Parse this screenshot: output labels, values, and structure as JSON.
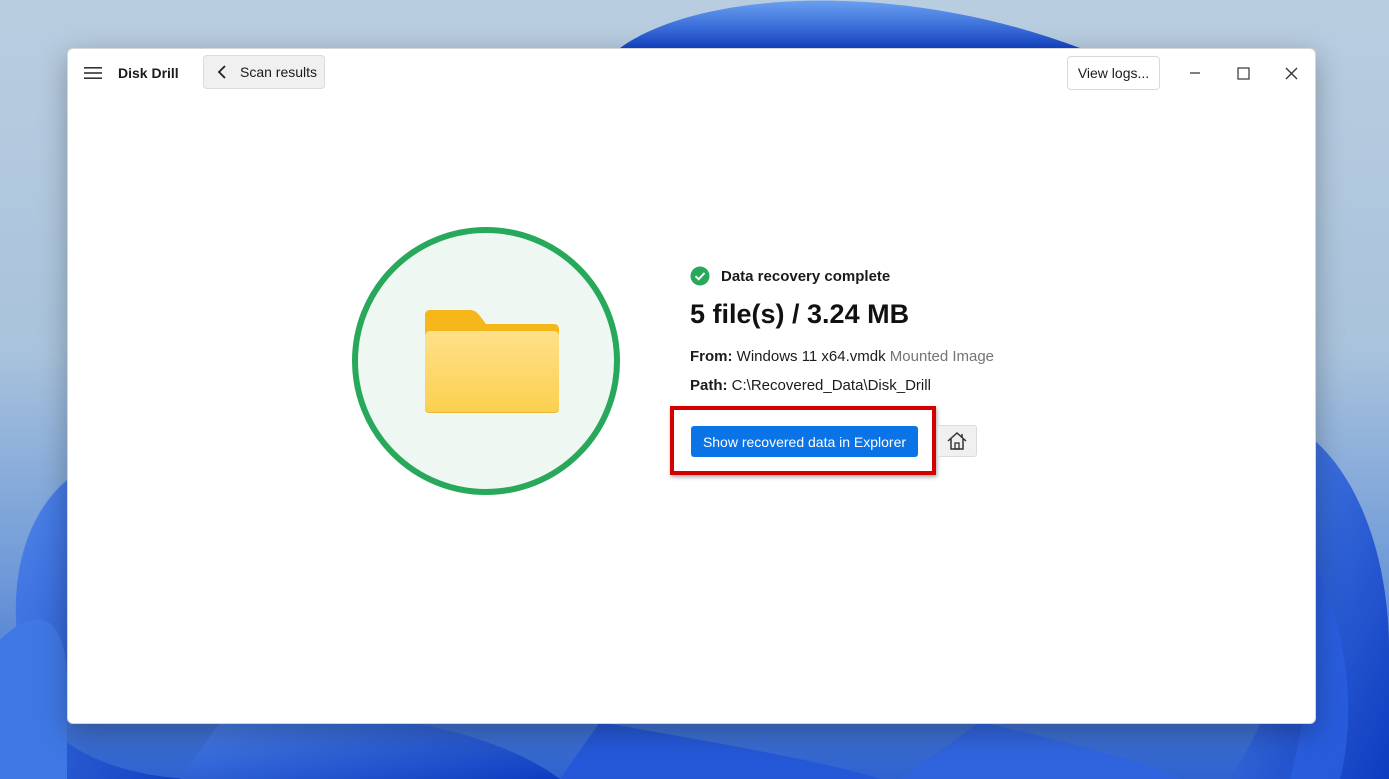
{
  "app": {
    "title": "Disk Drill"
  },
  "toolbar": {
    "back_label": "Scan results",
    "view_logs_label": "View logs..."
  },
  "result": {
    "status_text": "Data recovery complete",
    "summary": "5 file(s) / 3.24 MB",
    "from_label": "From:",
    "from_value": "Windows 11 x64.vmdk",
    "from_type": "Mounted Image",
    "path_label": "Path:",
    "path_value": "C:\\Recovered_Data\\Disk_Drill",
    "show_button_label": "Show recovered data in Explorer"
  },
  "icons": {
    "menu": "hamburger-icon",
    "back": "chevron-left-icon",
    "minimize": "minimize-icon",
    "maximize": "maximize-icon",
    "close": "close-icon",
    "status": "check-circle-icon",
    "folder": "folder-icon",
    "home": "home-icon"
  },
  "colors": {
    "accent": "#0a74e6",
    "success": "#27a85a",
    "highlight": "#d40000",
    "folder": "#fcd15a"
  }
}
